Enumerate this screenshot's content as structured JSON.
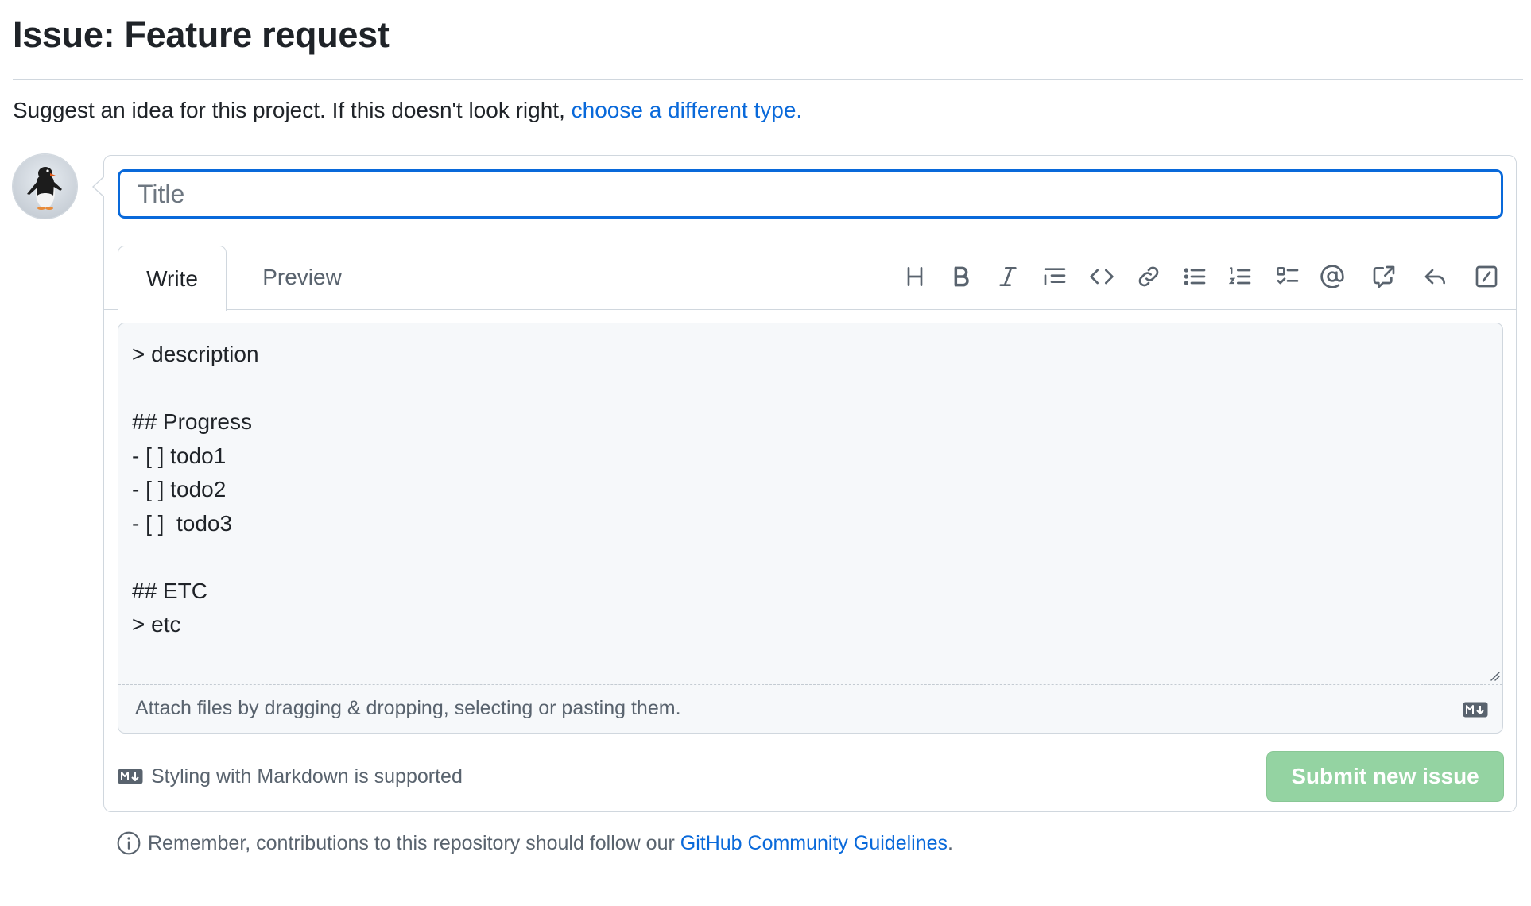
{
  "page": {
    "title": "Issue: Feature request",
    "subtitle_text": "Suggest an idea for this project. If this doesn't look right, ",
    "subtitle_link": "choose a different type."
  },
  "form": {
    "title_placeholder": "Title",
    "title_value": "",
    "tabs": [
      {
        "label": "Write",
        "active": true
      },
      {
        "label": "Preview",
        "active": false
      }
    ],
    "toolbar": [
      "heading-icon",
      "bold-icon",
      "italic-icon",
      "quote-icon",
      "code-icon",
      "link-icon",
      "unordered-list-icon",
      "ordered-list-icon",
      "tasklist-icon",
      "mention-icon",
      "cross-reference-icon",
      "reply-icon",
      "slash-command-icon"
    ],
    "body_text": "> description\n\n## Progress\n- [ ] todo1\n- [ ] todo2\n- [ ]  todo3\n\n## ETC\n> etc",
    "attach_hint": "Attach files by dragging & dropping, selecting or pasting them.",
    "markdown_note": "Styling with Markdown is supported",
    "submit_label": "Submit new issue"
  },
  "footer": {
    "text": "Remember, contributions to this repository should follow our ",
    "link": "GitHub Community Guidelines",
    "suffix": "."
  },
  "colors": {
    "accent": "#0969da",
    "submit_disabled_bg": "#94d3a2",
    "border": "#d0d7de",
    "muted_text": "#59636e"
  }
}
